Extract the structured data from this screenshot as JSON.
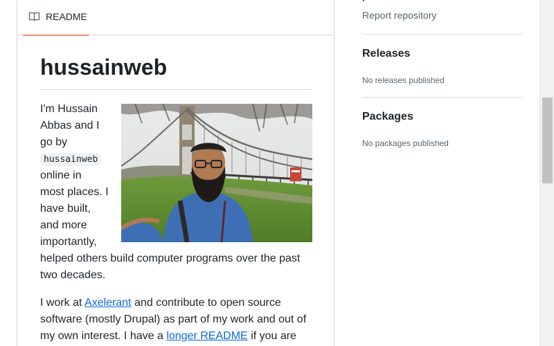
{
  "readme": {
    "tab_label": "README",
    "title": "hussainweb",
    "photo_alt": "Selfie in front of a suspension bridge",
    "intro": {
      "p1": "I'm Hussain",
      "p2": "Abbas and I",
      "p3": "go by",
      "code": "hussainweb",
      "p4": "online in",
      "p5": "most places. I",
      "p6": "have built,",
      "p7": "and more",
      "p8": "importantly,",
      "p9": "helped others build computer programs over the past",
      "p10": "two decades."
    },
    "second": {
      "a": "I work at ",
      "link1": "Axelerant",
      "b": " and contribute to open source",
      "c": "software (mostly Drupal) as part of my work and out of",
      "d": "my own interest. I have a ",
      "link2": "longer README",
      "e": " if you are"
    }
  },
  "sidebar": {
    "report_label": "Report repository",
    "releases_heading": "Releases",
    "releases_note": "No releases published",
    "packages_heading": "Packages",
    "packages_note": "No packages published"
  },
  "colors": {
    "accent_underline": "#fd8c73",
    "link": "#0969da",
    "muted": "#59636e"
  },
  "icons": [
    "book-icon",
    "flag-icon"
  ]
}
